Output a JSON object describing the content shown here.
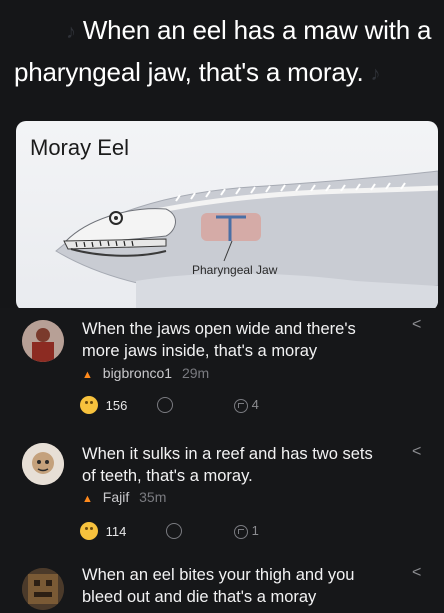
{
  "title": {
    "line1": "When an eel has a maw with a",
    "line2": "pharyngeal jaw, that's a moray.",
    "note_icon": "music-note-icon"
  },
  "image": {
    "heading": "Moray Eel",
    "label": "Pharyngeal Jaw"
  },
  "comments": [
    {
      "text": "When the jaws open wide and there's more jaws inside, that's a moray",
      "user": "bigbronco1",
      "time": "29m",
      "likes": "156",
      "replies": "4"
    },
    {
      "text": "When it sulks in a reef and has two sets of teeth, that's a moray.",
      "user": "Fajif",
      "time": "35m",
      "likes": "114",
      "replies": "1"
    },
    {
      "text": "When an eel bites your thigh and you bleed out and die that's a moray"
    }
  ],
  "colors": {
    "background": "#151618",
    "accent_flame": "#ff8a1c",
    "emoji": "#f7c23d"
  }
}
